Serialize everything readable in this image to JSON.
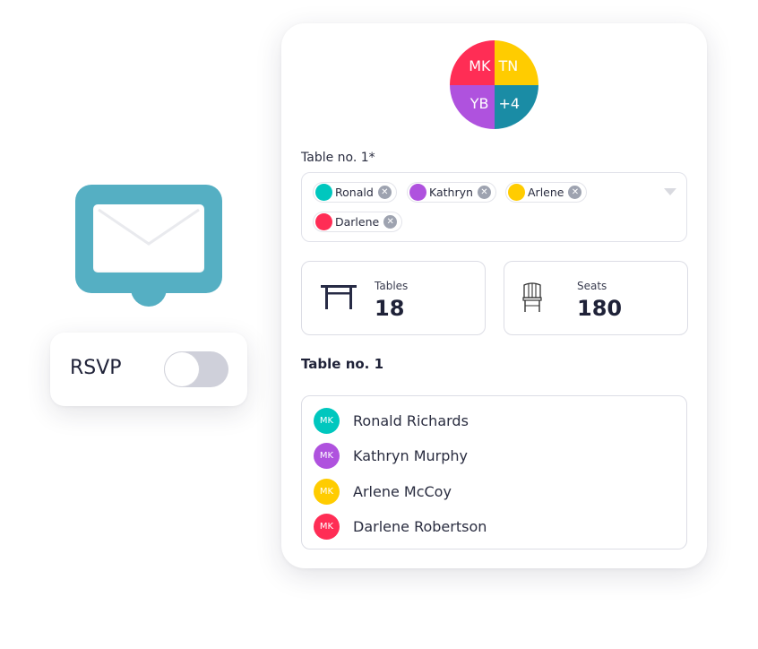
{
  "avatar_group": {
    "segments": [
      {
        "initials": "MK",
        "color": "#ff2d55"
      },
      {
        "initials": "TN",
        "color": "#ffcc00"
      },
      {
        "initials": "YB",
        "color": "#af52de"
      },
      {
        "initials": "+4",
        "color": "#1a8ca5"
      }
    ]
  },
  "table_select": {
    "label": "Table no. 1*",
    "chips": [
      {
        "name": "Ronald",
        "color": "#00c7be"
      },
      {
        "name": "Kathryn",
        "color": "#af52de"
      },
      {
        "name": "Arlene",
        "color": "#ffcc00"
      },
      {
        "name": "Darlene",
        "color": "#ff2d55"
      }
    ],
    "remove_glyph": "✕",
    "dropdown_icon": "chevron-down-icon"
  },
  "stats": {
    "tables": {
      "label": "Tables",
      "value": "18",
      "icon": "table-icon"
    },
    "seats": {
      "label": "Seats",
      "value": "180",
      "icon": "chair-icon"
    }
  },
  "guest_list": {
    "title": "Table no. 1",
    "guests": [
      {
        "initials": "MK",
        "name": "Ronald Richards",
        "color": "#00c7be"
      },
      {
        "initials": "MK",
        "name": "Kathryn Murphy",
        "color": "#af52de"
      },
      {
        "initials": "MK",
        "name": "Arlene McCoy",
        "color": "#ffcc00"
      },
      {
        "initials": "MK",
        "name": "Darlene Robertson",
        "color": "#ff2d55"
      }
    ]
  },
  "mail_badge": {
    "icon": "envelope-icon",
    "color": "#55afc3"
  },
  "rsvp": {
    "label": "RSVP",
    "enabled": false
  }
}
